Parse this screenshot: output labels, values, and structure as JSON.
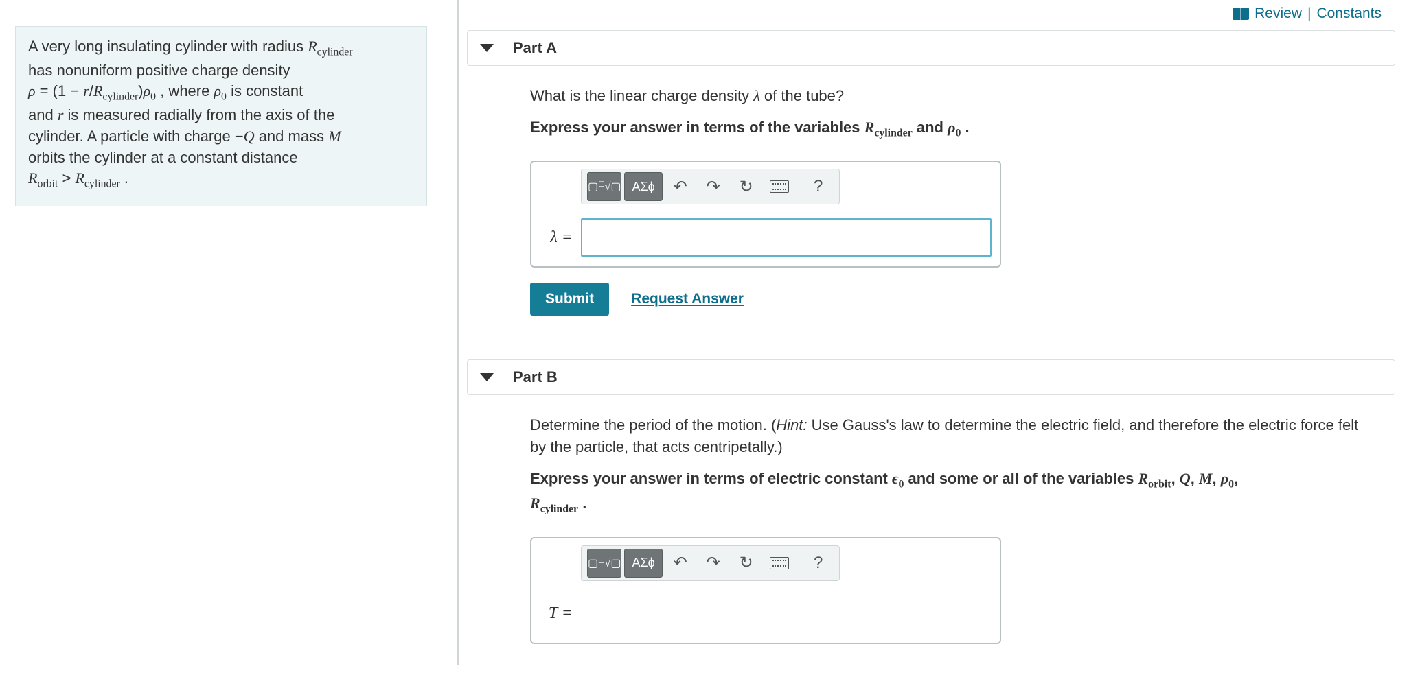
{
  "topbar": {
    "review": "Review",
    "sep": "|",
    "constants": "Constants"
  },
  "problem": {
    "line1a": "A very long insulating cylinder with radius ",
    "Rcyl": "R",
    "Rcyl_sub": "cylinder",
    "line2a": "has nonuniform positive charge density",
    "eq_lhs_rho": "ρ",
    "eq_eq": " = ",
    "eq_open": "(1 − ",
    "eq_r": "r",
    "eq_slash": "/",
    "eq_close": ")",
    "eq_rho0": "ρ",
    "eq_rho0_sub": "0",
    "line3_mid": " , where ",
    "line3_rho0": "ρ",
    "line3_rho0_sub": "0",
    "line3_end": " is constant",
    "line4a": "and ",
    "line4_r": "r",
    "line4b": " is measured radially from the axis of the",
    "line5a": "cylinder. A particle with charge ",
    "line5_minusQ": "−",
    "line5_Q": "Q",
    "line5_mid": " and mass ",
    "line5_M": "M",
    "line6": "orbits the cylinder at a constant distance",
    "line7_Rorbit": "R",
    "line7_Rorbit_sub": "orbit",
    "line7_gt": " > ",
    "line7_Rcyl": "R",
    "line7_Rcyl_sub": "cylinder",
    "line7_dot": " ."
  },
  "partA": {
    "title": "Part A",
    "q_pre": "What is the linear charge density ",
    "q_lambda": "λ",
    "q_post": " of the tube?",
    "instruct_pre": "Express your answer in terms of the variables ",
    "instruct_Rcyl": "R",
    "instruct_Rcyl_sub": "cylinder",
    "instruct_and": " and ",
    "instruct_rho0": "ρ",
    "instruct_rho0_sub": "0",
    "instruct_dot": " .",
    "var_label": "λ =",
    "submit": "Submit",
    "request": "Request Answer"
  },
  "partB": {
    "title": "Part B",
    "q1a": "Determine the period of the motion. (",
    "q1_hint": "Hint:",
    "q1b": " Use Gauss's law to determine the electric field, and therefore the electric force felt by the particle, that acts centripetally.)",
    "instruct_pre": "Express your answer in terms of electric constant ",
    "eps": "ϵ",
    "eps_sub": "0",
    "instruct_mid": " and some or all of the variables ",
    "v1": "R",
    "v1_sub": "orbit",
    "c": ", ",
    "v2": "Q",
    "v3": "M",
    "v4": "ρ",
    "v4_sub": "0",
    "v5": "R",
    "v5_sub": "cylinder",
    "instruct_dot": " .",
    "var_label": "T ="
  },
  "toolbar": {
    "templates": "▭√▭",
    "greek": "ΑΣϕ",
    "help": "?"
  }
}
